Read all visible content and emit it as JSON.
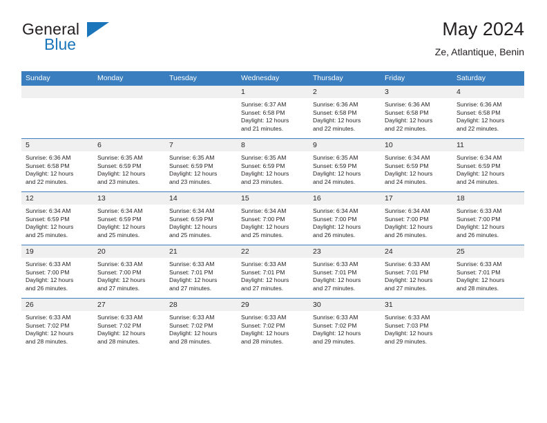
{
  "logo": {
    "word1": "General",
    "word2": "Blue",
    "triangle_color": "#1b75bb"
  },
  "header": {
    "title": "May 2024",
    "subtitle": "Ze, Atlantique, Benin"
  },
  "colors": {
    "header_blue": "#3a7ebf",
    "daynum_band": "#f0f0f0",
    "text": "#231f20"
  },
  "weekday_headers": [
    "Sunday",
    "Monday",
    "Tuesday",
    "Wednesday",
    "Thursday",
    "Friday",
    "Saturday"
  ],
  "weeks": [
    [
      {
        "day": "",
        "lines": [
          "",
          "",
          "",
          ""
        ]
      },
      {
        "day": "",
        "lines": [
          "",
          "",
          "",
          ""
        ]
      },
      {
        "day": "",
        "lines": [
          "",
          "",
          "",
          ""
        ]
      },
      {
        "day": "1",
        "lines": [
          "Sunrise: 6:37 AM",
          "Sunset: 6:58 PM",
          "Daylight: 12 hours",
          "and 21 minutes."
        ]
      },
      {
        "day": "2",
        "lines": [
          "Sunrise: 6:36 AM",
          "Sunset: 6:58 PM",
          "Daylight: 12 hours",
          "and 22 minutes."
        ]
      },
      {
        "day": "3",
        "lines": [
          "Sunrise: 6:36 AM",
          "Sunset: 6:58 PM",
          "Daylight: 12 hours",
          "and 22 minutes."
        ]
      },
      {
        "day": "4",
        "lines": [
          "Sunrise: 6:36 AM",
          "Sunset: 6:58 PM",
          "Daylight: 12 hours",
          "and 22 minutes."
        ]
      }
    ],
    [
      {
        "day": "5",
        "lines": [
          "Sunrise: 6:36 AM",
          "Sunset: 6:58 PM",
          "Daylight: 12 hours",
          "and 22 minutes."
        ]
      },
      {
        "day": "6",
        "lines": [
          "Sunrise: 6:35 AM",
          "Sunset: 6:59 PM",
          "Daylight: 12 hours",
          "and 23 minutes."
        ]
      },
      {
        "day": "7",
        "lines": [
          "Sunrise: 6:35 AM",
          "Sunset: 6:59 PM",
          "Daylight: 12 hours",
          "and 23 minutes."
        ]
      },
      {
        "day": "8",
        "lines": [
          "Sunrise: 6:35 AM",
          "Sunset: 6:59 PM",
          "Daylight: 12 hours",
          "and 23 minutes."
        ]
      },
      {
        "day": "9",
        "lines": [
          "Sunrise: 6:35 AM",
          "Sunset: 6:59 PM",
          "Daylight: 12 hours",
          "and 24 minutes."
        ]
      },
      {
        "day": "10",
        "lines": [
          "Sunrise: 6:34 AM",
          "Sunset: 6:59 PM",
          "Daylight: 12 hours",
          "and 24 minutes."
        ]
      },
      {
        "day": "11",
        "lines": [
          "Sunrise: 6:34 AM",
          "Sunset: 6:59 PM",
          "Daylight: 12 hours",
          "and 24 minutes."
        ]
      }
    ],
    [
      {
        "day": "12",
        "lines": [
          "Sunrise: 6:34 AM",
          "Sunset: 6:59 PM",
          "Daylight: 12 hours",
          "and 25 minutes."
        ]
      },
      {
        "day": "13",
        "lines": [
          "Sunrise: 6:34 AM",
          "Sunset: 6:59 PM",
          "Daylight: 12 hours",
          "and 25 minutes."
        ]
      },
      {
        "day": "14",
        "lines": [
          "Sunrise: 6:34 AM",
          "Sunset: 6:59 PM",
          "Daylight: 12 hours",
          "and 25 minutes."
        ]
      },
      {
        "day": "15",
        "lines": [
          "Sunrise: 6:34 AM",
          "Sunset: 7:00 PM",
          "Daylight: 12 hours",
          "and 25 minutes."
        ]
      },
      {
        "day": "16",
        "lines": [
          "Sunrise: 6:34 AM",
          "Sunset: 7:00 PM",
          "Daylight: 12 hours",
          "and 26 minutes."
        ]
      },
      {
        "day": "17",
        "lines": [
          "Sunrise: 6:34 AM",
          "Sunset: 7:00 PM",
          "Daylight: 12 hours",
          "and 26 minutes."
        ]
      },
      {
        "day": "18",
        "lines": [
          "Sunrise: 6:33 AM",
          "Sunset: 7:00 PM",
          "Daylight: 12 hours",
          "and 26 minutes."
        ]
      }
    ],
    [
      {
        "day": "19",
        "lines": [
          "Sunrise: 6:33 AM",
          "Sunset: 7:00 PM",
          "Daylight: 12 hours",
          "and 26 minutes."
        ]
      },
      {
        "day": "20",
        "lines": [
          "Sunrise: 6:33 AM",
          "Sunset: 7:00 PM",
          "Daylight: 12 hours",
          "and 27 minutes."
        ]
      },
      {
        "day": "21",
        "lines": [
          "Sunrise: 6:33 AM",
          "Sunset: 7:01 PM",
          "Daylight: 12 hours",
          "and 27 minutes."
        ]
      },
      {
        "day": "22",
        "lines": [
          "Sunrise: 6:33 AM",
          "Sunset: 7:01 PM",
          "Daylight: 12 hours",
          "and 27 minutes."
        ]
      },
      {
        "day": "23",
        "lines": [
          "Sunrise: 6:33 AM",
          "Sunset: 7:01 PM",
          "Daylight: 12 hours",
          "and 27 minutes."
        ]
      },
      {
        "day": "24",
        "lines": [
          "Sunrise: 6:33 AM",
          "Sunset: 7:01 PM",
          "Daylight: 12 hours",
          "and 27 minutes."
        ]
      },
      {
        "day": "25",
        "lines": [
          "Sunrise: 6:33 AM",
          "Sunset: 7:01 PM",
          "Daylight: 12 hours",
          "and 28 minutes."
        ]
      }
    ],
    [
      {
        "day": "26",
        "lines": [
          "Sunrise: 6:33 AM",
          "Sunset: 7:02 PM",
          "Daylight: 12 hours",
          "and 28 minutes."
        ]
      },
      {
        "day": "27",
        "lines": [
          "Sunrise: 6:33 AM",
          "Sunset: 7:02 PM",
          "Daylight: 12 hours",
          "and 28 minutes."
        ]
      },
      {
        "day": "28",
        "lines": [
          "Sunrise: 6:33 AM",
          "Sunset: 7:02 PM",
          "Daylight: 12 hours",
          "and 28 minutes."
        ]
      },
      {
        "day": "29",
        "lines": [
          "Sunrise: 6:33 AM",
          "Sunset: 7:02 PM",
          "Daylight: 12 hours",
          "and 28 minutes."
        ]
      },
      {
        "day": "30",
        "lines": [
          "Sunrise: 6:33 AM",
          "Sunset: 7:02 PM",
          "Daylight: 12 hours",
          "and 29 minutes."
        ]
      },
      {
        "day": "31",
        "lines": [
          "Sunrise: 6:33 AM",
          "Sunset: 7:03 PM",
          "Daylight: 12 hours",
          "and 29 minutes."
        ]
      },
      {
        "day": "",
        "lines": [
          "",
          "",
          "",
          ""
        ]
      }
    ]
  ]
}
